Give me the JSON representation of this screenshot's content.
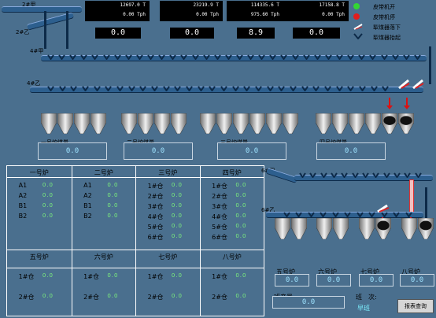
{
  "belt_labels": {
    "b2_jia": "2#甲",
    "b2_yi": "2#乙",
    "b4_jia": "4#甲",
    "b4_yi": "4#乙",
    "b6_jia": "6#甲",
    "b6_yi": "6#乙"
  },
  "displays": [
    {
      "top": "12697.0 T",
      "bottom": "0.00 Tph",
      "small": "0.0"
    },
    {
      "top": "23219.9 T",
      "bottom": "0.00 Tph",
      "small": "0.0"
    },
    {
      "top": "114335.6 T",
      "bottom": "975.60 Tph",
      "small": "8.9"
    },
    {
      "top": "17158.8 T",
      "bottom": "0.00 Tph",
      "small": "0.0"
    }
  ],
  "legend": [
    {
      "label": "皮带机开",
      "color": "#33d633"
    },
    {
      "label": "皮带机停",
      "color": "#e21d1d"
    },
    {
      "label": "犁煤器落下"
    },
    {
      "label": "犁煤器抬起"
    }
  ],
  "boilers": [
    {
      "label": "一号炉煤量",
      "value": "0.0"
    },
    {
      "label": "二号炉煤量",
      "value": "0.0"
    },
    {
      "label": "三号炉煤量",
      "value": "0.0"
    },
    {
      "label": "四号炉煤量",
      "value": "0.0"
    }
  ],
  "table_top": [
    {
      "title": "一号炉",
      "rows": [
        "A1",
        "A2",
        "B1",
        "B2"
      ]
    },
    {
      "title": "二号炉",
      "rows": [
        "A1",
        "A2",
        "B1",
        "B2"
      ]
    },
    {
      "title": "三号炉",
      "rows": [
        "1#仓",
        "2#仓",
        "3#仓",
        "4#仓",
        "5#仓",
        "6#仓"
      ]
    },
    {
      "title": "四号炉",
      "rows": [
        "1#仓",
        "2#仓",
        "3#仓",
        "4#仓",
        "5#仓",
        "6#仓"
      ]
    }
  ],
  "table_bottom": [
    {
      "title": "五号炉",
      "rows": [
        "1#仓",
        "2#仓"
      ]
    },
    {
      "title": "六号炉",
      "rows": [
        "1#仓",
        "2#仓"
      ]
    },
    {
      "title": "七号炉",
      "rows": [
        "1#仓",
        "2#仓"
      ]
    },
    {
      "title": "八号炉",
      "rows": [
        "1#仓",
        "2#仓"
      ]
    }
  ],
  "cell_value": "0.0",
  "boilers_lower": [
    {
      "label": "五号炉",
      "value": "0.0"
    },
    {
      "label": "六号炉",
      "value": "0.0"
    },
    {
      "label": "七号炉",
      "value": "0.0"
    },
    {
      "label": "八号炉",
      "value": "0.0"
    }
  ],
  "shift": {
    "label": "班产量",
    "value": "0.0",
    "shift_label": "班　次:",
    "shift_value": "早班"
  },
  "report_button": "报表查询"
}
